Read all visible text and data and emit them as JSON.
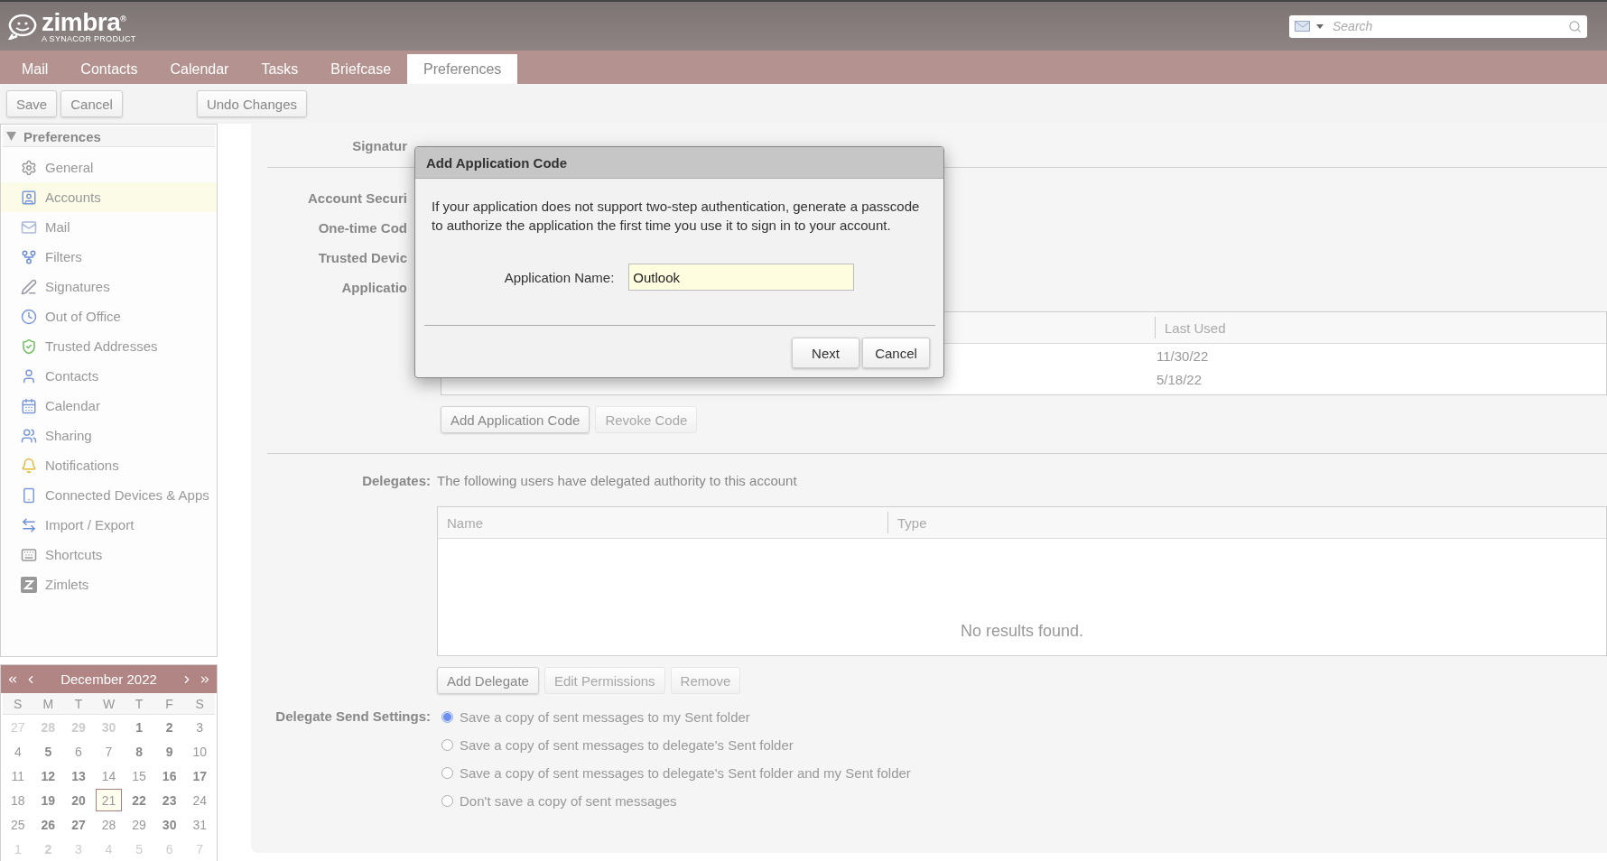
{
  "logo": {
    "name": "zimbra",
    "mark": "®",
    "tagline": "A SYNACOR PRODUCT"
  },
  "search": {
    "placeholder": "Search"
  },
  "tabs": [
    {
      "label": "Mail",
      "selected": false
    },
    {
      "label": "Contacts",
      "selected": false
    },
    {
      "label": "Calendar",
      "selected": false
    },
    {
      "label": "Tasks",
      "selected": false
    },
    {
      "label": "Briefcase",
      "selected": false
    },
    {
      "label": "Preferences",
      "selected": true
    }
  ],
  "toolbar": {
    "left_buttons": [
      "Save",
      "Cancel"
    ],
    "undo_button": "Undo Changes"
  },
  "sidebar": {
    "title": "Preferences",
    "expanded": true,
    "items": [
      {
        "label": "General",
        "selected": false
      },
      {
        "label": "Accounts",
        "selected": true
      },
      {
        "label": "Mail",
        "selected": false
      },
      {
        "label": "Filters",
        "selected": false
      },
      {
        "label": "Signatures",
        "selected": false
      },
      {
        "label": "Out of Office",
        "selected": false
      },
      {
        "label": "Trusted Addresses",
        "selected": false
      },
      {
        "label": "Contacts",
        "selected": false
      },
      {
        "label": "Calendar",
        "selected": false
      },
      {
        "label": "Sharing",
        "selected": false
      },
      {
        "label": "Notifications",
        "selected": false
      },
      {
        "label": "Connected Devices & Apps",
        "selected": false
      },
      {
        "label": "Import / Export",
        "selected": false
      },
      {
        "label": "Shortcuts",
        "selected": false
      },
      {
        "label": "Zimlets",
        "selected": false
      }
    ]
  },
  "mini_calendar": {
    "title": "December 2022",
    "weekdays": [
      "S",
      "M",
      "T",
      "W",
      "T",
      "F",
      "S"
    ],
    "weeks": [
      [
        {
          "d": "27",
          "other": true,
          "bold": false,
          "selected": false
        },
        {
          "d": "28",
          "other": true,
          "bold": true,
          "selected": false
        },
        {
          "d": "29",
          "other": true,
          "bold": true,
          "selected": false
        },
        {
          "d": "30",
          "other": true,
          "bold": true,
          "selected": false
        },
        {
          "d": "1",
          "other": false,
          "bold": true,
          "selected": false
        },
        {
          "d": "2",
          "other": false,
          "bold": true,
          "selected": false
        },
        {
          "d": "3",
          "other": false,
          "bold": false,
          "selected": false
        }
      ],
      [
        {
          "d": "4",
          "other": false,
          "bold": false,
          "selected": false
        },
        {
          "d": "5",
          "other": false,
          "bold": true,
          "selected": false
        },
        {
          "d": "6",
          "other": false,
          "bold": false,
          "selected": false
        },
        {
          "d": "7",
          "other": false,
          "bold": false,
          "selected": false
        },
        {
          "d": "8",
          "other": false,
          "bold": true,
          "selected": false
        },
        {
          "d": "9",
          "other": false,
          "bold": true,
          "selected": false
        },
        {
          "d": "10",
          "other": false,
          "bold": false,
          "selected": false
        }
      ],
      [
        {
          "d": "11",
          "other": false,
          "bold": false,
          "selected": false
        },
        {
          "d": "12",
          "other": false,
          "bold": true,
          "selected": false
        },
        {
          "d": "13",
          "other": false,
          "bold": true,
          "selected": false
        },
        {
          "d": "14",
          "other": false,
          "bold": false,
          "selected": false
        },
        {
          "d": "15",
          "other": false,
          "bold": false,
          "selected": false
        },
        {
          "d": "16",
          "other": false,
          "bold": true,
          "selected": false
        },
        {
          "d": "17",
          "other": false,
          "bold": true,
          "selected": false
        }
      ],
      [
        {
          "d": "18",
          "other": false,
          "bold": false,
          "selected": false
        },
        {
          "d": "19",
          "other": false,
          "bold": true,
          "selected": false
        },
        {
          "d": "20",
          "other": false,
          "bold": true,
          "selected": false
        },
        {
          "d": "21",
          "other": false,
          "bold": false,
          "selected": true
        },
        {
          "d": "22",
          "other": false,
          "bold": true,
          "selected": false
        },
        {
          "d": "23",
          "other": false,
          "bold": true,
          "selected": false
        },
        {
          "d": "24",
          "other": false,
          "bold": false,
          "selected": false
        }
      ],
      [
        {
          "d": "25",
          "other": false,
          "bold": false,
          "selected": false
        },
        {
          "d": "26",
          "other": false,
          "bold": true,
          "selected": false
        },
        {
          "d": "27",
          "other": false,
          "bold": true,
          "selected": false
        },
        {
          "d": "28",
          "other": false,
          "bold": false,
          "selected": false
        },
        {
          "d": "29",
          "other": false,
          "bold": false,
          "selected": false
        },
        {
          "d": "30",
          "other": false,
          "bold": true,
          "selected": false
        },
        {
          "d": "31",
          "other": false,
          "bold": false,
          "selected": false
        }
      ],
      [
        {
          "d": "1",
          "other": true,
          "bold": false,
          "selected": false
        },
        {
          "d": "2",
          "other": true,
          "bold": true,
          "selected": false
        },
        {
          "d": "3",
          "other": true,
          "bold": false,
          "selected": false
        },
        {
          "d": "4",
          "other": true,
          "bold": false,
          "selected": false
        },
        {
          "d": "5",
          "other": true,
          "bold": false,
          "selected": false
        },
        {
          "d": "6",
          "other": true,
          "bold": false,
          "selected": false
        },
        {
          "d": "7",
          "other": true,
          "bold": false,
          "selected": false
        }
      ]
    ]
  },
  "content": {
    "signature_label": "Signatur",
    "security_labels": [
      "Account Securi",
      "One-time Cod",
      "Trusted Devic",
      "Applicatio"
    ],
    "app_codes": {
      "column_2": "Last Used",
      "rows": [
        "11/30/22",
        "5/18/22"
      ],
      "buttons": [
        {
          "label": "Add Application Code",
          "disabled": false
        },
        {
          "label": "Revoke Code",
          "disabled": true
        }
      ]
    },
    "delegates": {
      "label": "Delegates:",
      "description": "The following users have delegated authority to this account",
      "columns": [
        "Name",
        "Type"
      ],
      "empty": "No results found.",
      "buttons": [
        {
          "label": "Add Delegate",
          "disabled": false
        },
        {
          "label": "Edit Permissions",
          "disabled": true
        },
        {
          "label": "Remove",
          "disabled": true
        }
      ]
    },
    "send_settings": {
      "label": "Delegate Send Settings:",
      "options": [
        {
          "label": "Save a copy of sent messages to my Sent folder",
          "selected": true
        },
        {
          "label": "Save a copy of sent messages to delegate's Sent folder",
          "selected": false
        },
        {
          "label": "Save a copy of sent messages to delegate's Sent folder and my Sent folder",
          "selected": false
        },
        {
          "label": "Don't save a copy of sent messages",
          "selected": false
        }
      ]
    }
  },
  "dialog": {
    "title": "Add Application Code",
    "message": "If your application does not support two-step authentication, generate a passcode to authorize the application the first time you use it to sign in to your account.",
    "field_label": "Application Name:",
    "field_value": "Outlook",
    "buttons": [
      "Next",
      "Cancel"
    ]
  }
}
